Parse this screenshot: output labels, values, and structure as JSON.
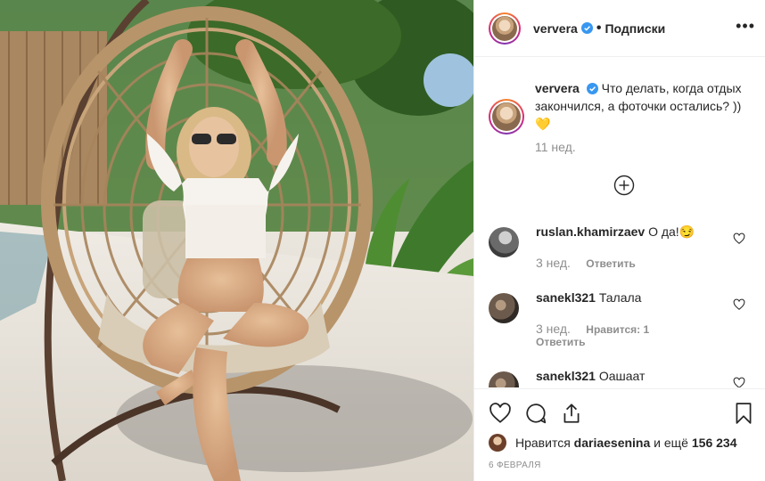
{
  "post": {
    "photo_alt": "photo-of-woman-in-rattan-hanging-chair",
    "author": "ververa",
    "follow_status": "Подписки",
    "more_glyph": "•••",
    "caption_text": "Что делать, когда отдых закончился, а фоточки остались? ))",
    "caption_emoji": "💛",
    "caption_age": "11 нед."
  },
  "comments": [
    {
      "user": "ruslan.khamirzaev",
      "text": "О да!",
      "emoji": "😏",
      "age": "3 нед.",
      "likes": "",
      "reply": "Ответить"
    },
    {
      "user": "sanekl321",
      "text": "Талала",
      "emoji": "",
      "age": "3 нед.",
      "likes": "Нравится: 1",
      "reply": "Ответить"
    },
    {
      "user": "sanekl321",
      "text": "Оашаат",
      "emoji": "",
      "age": "",
      "likes": "",
      "reply": ""
    }
  ],
  "likes_bar": {
    "prefix": "Нравится",
    "user": "dariaesenina",
    "middle": "и ещё",
    "count": "156 234"
  },
  "date": "6 ФЕВРАЛЯ",
  "icons": {
    "like": "heart-icon",
    "comment": "comment-icon",
    "share": "share-icon",
    "save": "bookmark-icon",
    "load_more": "plus-circle-icon",
    "verified": "verified-badge-icon"
  },
  "colors": {
    "verified": "#3897f0",
    "muted": "#8e8e8e",
    "text": "#262626"
  }
}
